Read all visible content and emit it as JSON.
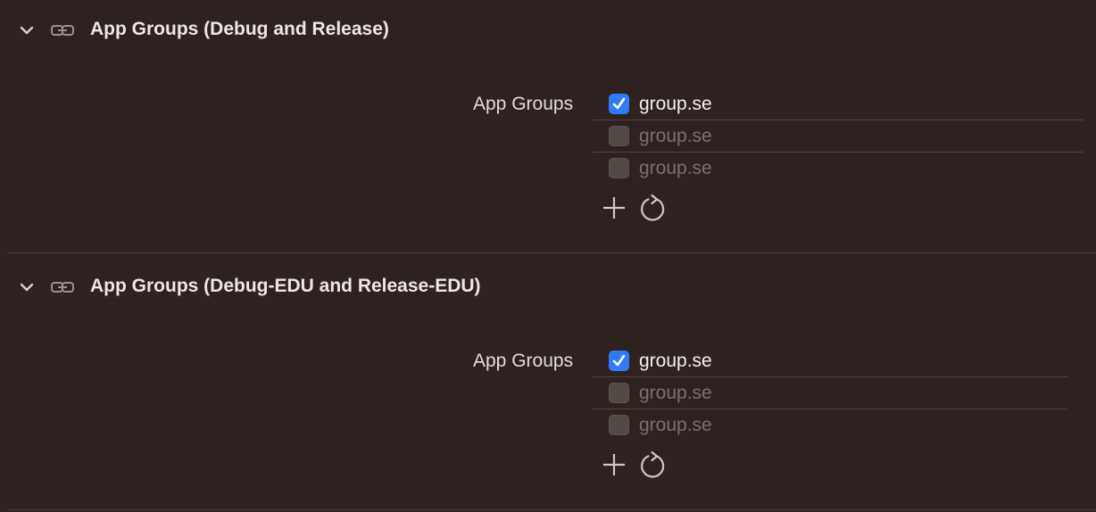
{
  "sections": [
    {
      "title": "App Groups (Debug and Release)",
      "row_label": "App Groups",
      "groups": [
        {
          "name": "group.se",
          "checked": true
        },
        {
          "name": "group.se",
          "checked": false
        },
        {
          "name": "group.se",
          "checked": false
        }
      ]
    },
    {
      "title": "App Groups (Debug-EDU and Release-EDU)",
      "row_label": "App Groups",
      "groups": [
        {
          "name": "group.se",
          "checked": true
        },
        {
          "name": "group.se",
          "checked": false
        },
        {
          "name": "group.se",
          "checked": false
        }
      ]
    }
  ],
  "icons": {
    "disclosure": "chevron-down-icon",
    "capability": "link-icon",
    "checkmark": "checkmark-icon",
    "add": "plus-icon",
    "refresh": "refresh-icon"
  },
  "colors": {
    "background": "#2e2220",
    "accent": "#2f7cf6",
    "text": "#e8e2de",
    "disabled_text": "#7a706c"
  }
}
